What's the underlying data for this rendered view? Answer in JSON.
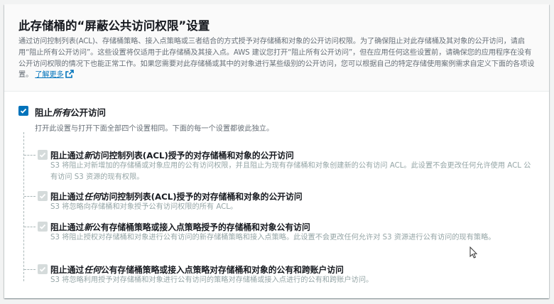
{
  "header": {
    "title": "此存储桶的“屏蔽公共访问权限”设置",
    "description": "通过访问控制列表(ACL)、存储桶策略、接入点策略或三者结合的方式授予对存储桶和对象的公开访问权限。为了确保阻止对此存储桶及其对象的公开访问，请启用“阻止所有公开访问”。这些设置将仅适用于此存储桶及其接入点。AWS 建议您打开“阻止所有公开访问”，但在应用任何这些设置前，请确保您的应用程序在没有公开访问权限的情况下也能正常工作。如果您需要对此存储桶或其中的对象进行某些级别的公开访问，您可以根据自己的特定存储使用案例需求自定义下面的各项设置。",
    "learn_more": "了解更多"
  },
  "master": {
    "label_prefix": "阻止",
    "label_em": "所有",
    "label_suffix": "公开访问",
    "checked": true,
    "description": "打开此设置与打开下面全部四个设置相同。下面的每一个设置都彼此独立。"
  },
  "settings": [
    {
      "label_prefix": "阻止通过",
      "label_em": "新",
      "label_suffix": "访问控制列表(ACL)授予的对存储桶和对象的公开访问",
      "description": "S3 将阻止对新增加的存储桶或对象应用的公有访问权限，并且阻止为现有存储桶和对象创建新的公有访问 ACL。此设置不会更改任何允许使用 ACL 公有访问 S3 资源的现有权限。",
      "checked": true
    },
    {
      "label_prefix": "阻止通过",
      "label_em": "任何",
      "label_suffix": "访问控制列表(ACL)授予的对存储桶和对象的公开访问",
      "description": "S3 将忽略向存储桶和对象授予公有访问权限的所有 ACL。",
      "checked": true
    },
    {
      "label_prefix": "阻止通过",
      "label_em": "新",
      "label_suffix": "公有存储桶策略或接入点策略授予的存储桶和对象公有访问",
      "description": "S3 将阻止授权对存储桶和对象进行公有访问的新存储桶策略和接入点策略。此设置不会更改任何允许对 S3 资源进行公有访问的现有策略。",
      "checked": true
    },
    {
      "label_prefix": "阻止通过",
      "label_em": "任何",
      "label_suffix": "公有存储桶策略或接入点策略对存储桶和对象的公有和跨账户访问",
      "description": "S3 将忽略利用授予对存储桶和对象进行公有访问的策略对存储桶或接入点进行的公有和跨账户访问。",
      "checked": true
    }
  ],
  "colors": {
    "accent": "#0073bb",
    "disabled_check": "#d5dbdb",
    "muted_text": "#687078",
    "disabled_text": "#95a5a6"
  }
}
